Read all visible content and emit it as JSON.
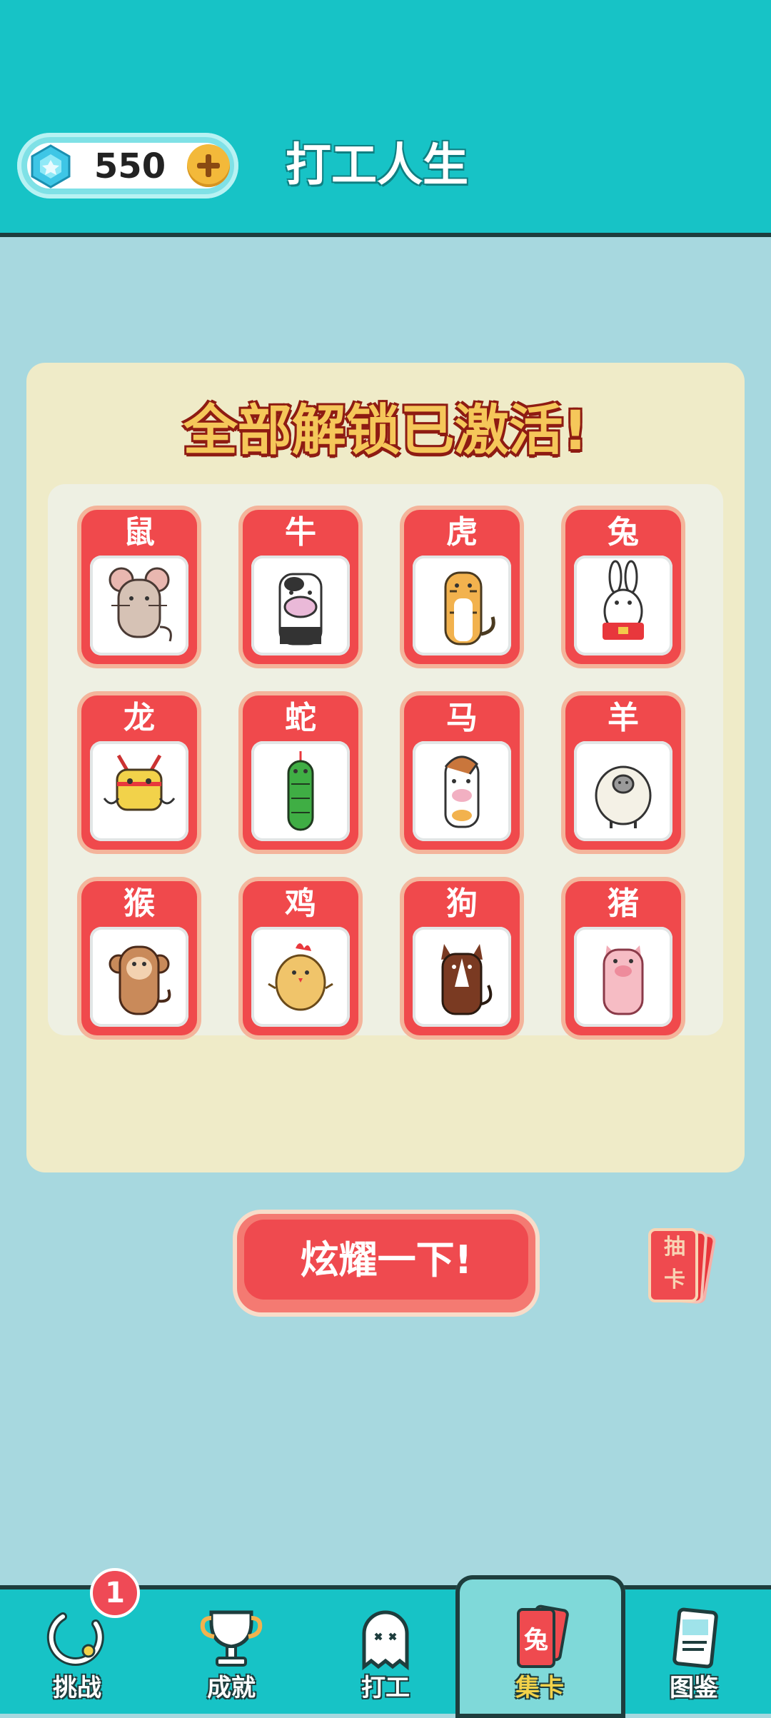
{
  "header": {
    "gem_count": "550",
    "title": "打工人生"
  },
  "panel": {
    "title": "全部解锁已激活!",
    "cards": [
      {
        "label": "鼠",
        "icon": "rat-icon"
      },
      {
        "label": "牛",
        "icon": "ox-icon"
      },
      {
        "label": "虎",
        "icon": "tiger-icon"
      },
      {
        "label": "兔",
        "icon": "rabbit-icon"
      },
      {
        "label": "龙",
        "icon": "dragon-icon"
      },
      {
        "label": "蛇",
        "icon": "snake-icon"
      },
      {
        "label": "马",
        "icon": "horse-icon"
      },
      {
        "label": "羊",
        "icon": "sheep-icon"
      },
      {
        "label": "猴",
        "icon": "monkey-icon"
      },
      {
        "label": "鸡",
        "icon": "chicken-icon"
      },
      {
        "label": "狗",
        "icon": "dog-icon"
      },
      {
        "label": "猪",
        "icon": "pig-icon"
      }
    ]
  },
  "actions": {
    "show_off_label": "炫耀一下!",
    "draw_card_label": "抽\n卡"
  },
  "nav": {
    "items": [
      {
        "label": "挑战",
        "icon": "challenge-icon",
        "badge": "1"
      },
      {
        "label": "成就",
        "icon": "trophy-icon"
      },
      {
        "label": "打工",
        "icon": "ghost-icon"
      },
      {
        "label": "集卡",
        "icon": "card-collection-icon",
        "active": true,
        "icon_text": "兔"
      },
      {
        "label": "图鉴",
        "icon": "catalog-icon"
      }
    ]
  },
  "colors": {
    "teal": "#17c3c6",
    "background": "#a7d8df",
    "panel": "#efebc8",
    "card_red": "#f0494c"
  }
}
